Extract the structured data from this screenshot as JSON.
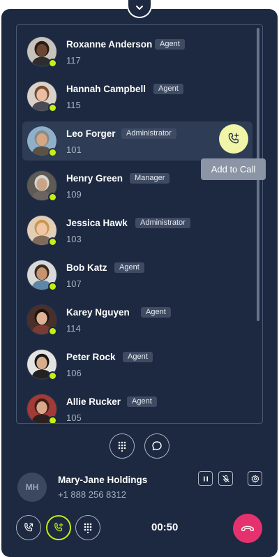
{
  "contacts": [
    {
      "name": "Roxanne Anderson",
      "role": "Agent",
      "ext": "117",
      "status": "online"
    },
    {
      "name": "Hannah Campbell",
      "role": "Agent",
      "ext": "115",
      "status": "online"
    },
    {
      "name": "Leo Forger",
      "role": "Administrator",
      "ext": "101",
      "status": "online"
    },
    {
      "name": "Henry Green",
      "role": "Manager",
      "ext": "109",
      "status": "online"
    },
    {
      "name": "Jessica Hawk",
      "role": "Administrator",
      "ext": "103",
      "status": "online"
    },
    {
      "name": "Bob Katz",
      "role": "Agent",
      "ext": "107",
      "status": "online"
    },
    {
      "name": "Karey Nguyen",
      "role": "Agent",
      "ext": "114",
      "status": "online"
    },
    {
      "name": "Peter Rock",
      "role": "Agent",
      "ext": "106",
      "status": "online"
    },
    {
      "name": "Allie Rucker",
      "role": "Agent",
      "ext": "105",
      "status": "online"
    }
  ],
  "hovered_contact": "Leo Forger",
  "tooltip": "Add to Call",
  "list_actions": [
    "dialpad-icon",
    "chat-icon"
  ],
  "call": {
    "initials": "MH",
    "name": "Mary-Jane Holdings",
    "number": "+1 888 256 8312",
    "timer": "00:50"
  },
  "colors": {
    "panel": "#1c2940",
    "presence": "#c6f014",
    "add_button": "#f0f5a8",
    "hangup": "#e5326f",
    "tooltip": "#8c95a5"
  }
}
